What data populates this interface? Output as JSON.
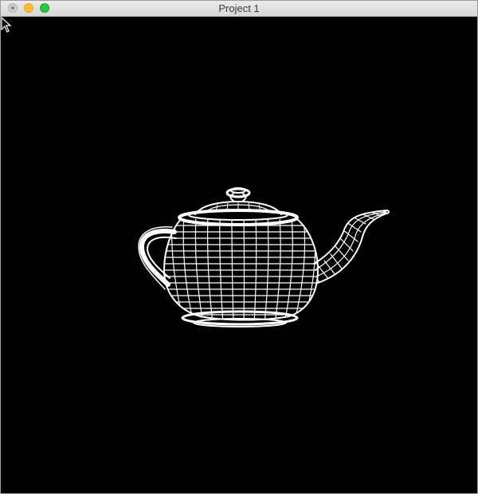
{
  "window": {
    "title": "Project 1"
  },
  "viewport": {
    "background": "#000000",
    "wire_color": "#ffffff",
    "model_icon": "teapot-wireframe"
  }
}
